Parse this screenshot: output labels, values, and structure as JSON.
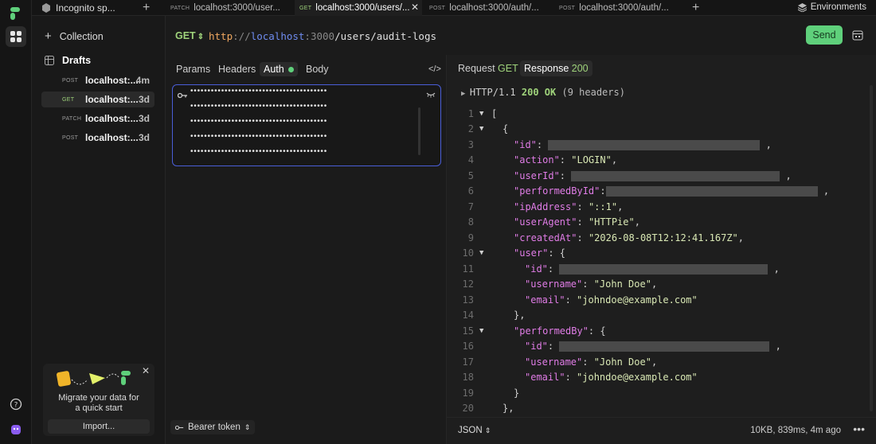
{
  "topbar": {
    "workspace": "Incognito sp...",
    "tabs": [
      {
        "method": "PATCH",
        "label": "localhost:3000/user..."
      },
      {
        "method": "GET",
        "label": "localhost:3000/users/..."
      },
      {
        "method": "POST",
        "label": "localhost:3000/auth/..."
      },
      {
        "method": "POST",
        "label": "localhost:3000/auth/..."
      }
    ],
    "environments": "Environments"
  },
  "sidebar": {
    "collection": "Collection",
    "drafts_title": "Drafts",
    "drafts": [
      {
        "method": "POST",
        "name": "localhost:...",
        "time": "4m"
      },
      {
        "method": "GET",
        "name": "localhost:...",
        "time": "3d"
      },
      {
        "method": "PATCH",
        "name": "localhost:...",
        "time": "3d"
      },
      {
        "method": "POST",
        "name": "localhost:...",
        "time": "3d"
      }
    ],
    "migrate_line1": "Migrate your data for",
    "migrate_line2": "a quick start",
    "import_label": "Import..."
  },
  "request": {
    "method": "GET",
    "url_scheme": "http",
    "url_sep": "://",
    "url_host": "localhost",
    "url_port": ":3000",
    "url_path": "/users/audit-logs",
    "send_label": "Send",
    "tabs": [
      "Params",
      "Headers",
      "Auth",
      "Body"
    ],
    "auth_token_masked": "••••••••••••••••••••••••••••••••••••••••",
    "auth_type": "Bearer token"
  },
  "response": {
    "request_tab_label": "Request",
    "request_tab_method": "GET",
    "response_tab_label": "Response",
    "response_tab_code": "200",
    "status_proto": "HTTP/1.1",
    "status_code": "200 OK",
    "status_headers": "(9 headers)",
    "format": "JSON",
    "meta": "10KB, 839ms, 4m ago",
    "body": {
      "action": "\"LOGIN\"",
      "ipAddress": "\"::1\"",
      "userAgent": "\"HTTPie\"",
      "createdAt": "\"2026-08-08T12:12:41.167Z\"",
      "user_username": "\"John Doe\"",
      "user_email": "\"johndoe@example.com\"",
      "performedBy_username": "\"John Doe\"",
      "performedBy_email": "\"johndoe@example.com\""
    }
  },
  "colors": {
    "accent_green": "#5fd07b",
    "focus_blue": "#4a5ed8",
    "json_key": "#e07ce6",
    "json_string": "#d9e8b4"
  }
}
